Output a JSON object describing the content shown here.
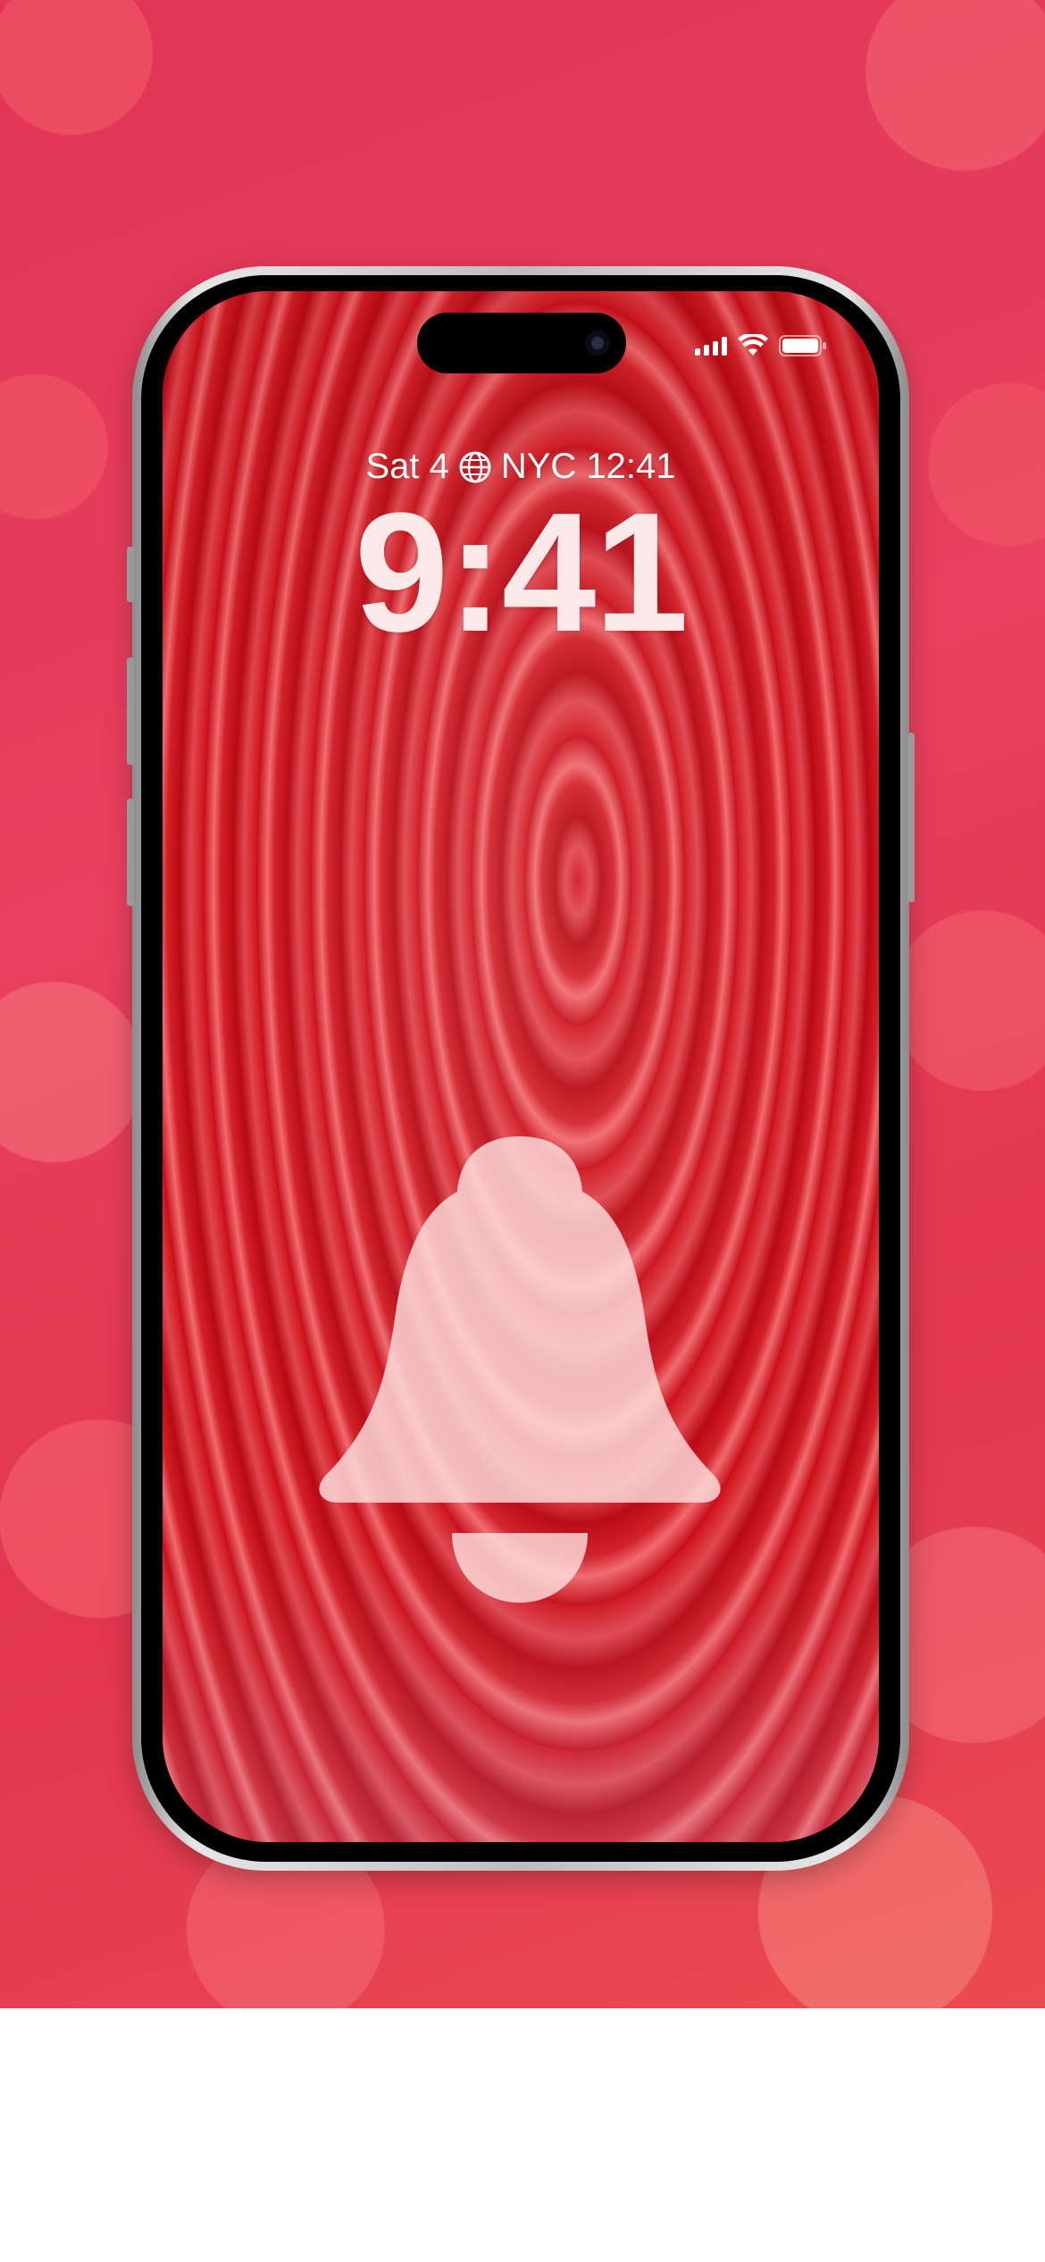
{
  "lock_screen": {
    "date_prefix": "Sat 4",
    "world_clock": "NYC 12:41",
    "time": "9:41"
  },
  "status_bar": {
    "signal_bars": 4,
    "wifi": "wifi-icon",
    "battery": "battery-icon"
  },
  "wallpaper": {
    "subject": "bell-icon",
    "accent": "#c8101c",
    "backdrop": "#e23456"
  }
}
